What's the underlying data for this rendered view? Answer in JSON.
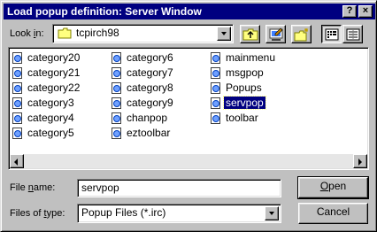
{
  "window": {
    "title": "Load popup definition: Server Window",
    "help_button": "?",
    "close_button": "×"
  },
  "look_in": {
    "label_pre": "Look ",
    "label_key": "i",
    "label_post": "n:",
    "value": "tcpirch98"
  },
  "toolbar": {
    "up_folder": "up-folder-icon",
    "desktop": "desktop-icon",
    "new_folder": "new-folder-icon",
    "list_view": "list-view-icon",
    "details_view": "details-view-icon"
  },
  "files": {
    "col1": [
      "category20",
      "category21",
      "category22",
      "category3",
      "category4",
      "category5"
    ],
    "col2": [
      "category6",
      "category7",
      "category8",
      "category9",
      "chanpop",
      "eztoolbar"
    ],
    "col3": [
      "mainmenu",
      "msgpop",
      "Popups",
      "servpop",
      "toolbar"
    ],
    "selected": "servpop"
  },
  "filename": {
    "label_pre": "File ",
    "label_key": "n",
    "label_post": "ame:",
    "value": "servpop"
  },
  "filetype": {
    "label_pre": "Files of ",
    "label_key": "t",
    "label_post": "ype:",
    "value": "Popup Files (*.irc)"
  },
  "buttons": {
    "open_key": "O",
    "open_rest": "pen",
    "cancel": "Cancel"
  }
}
